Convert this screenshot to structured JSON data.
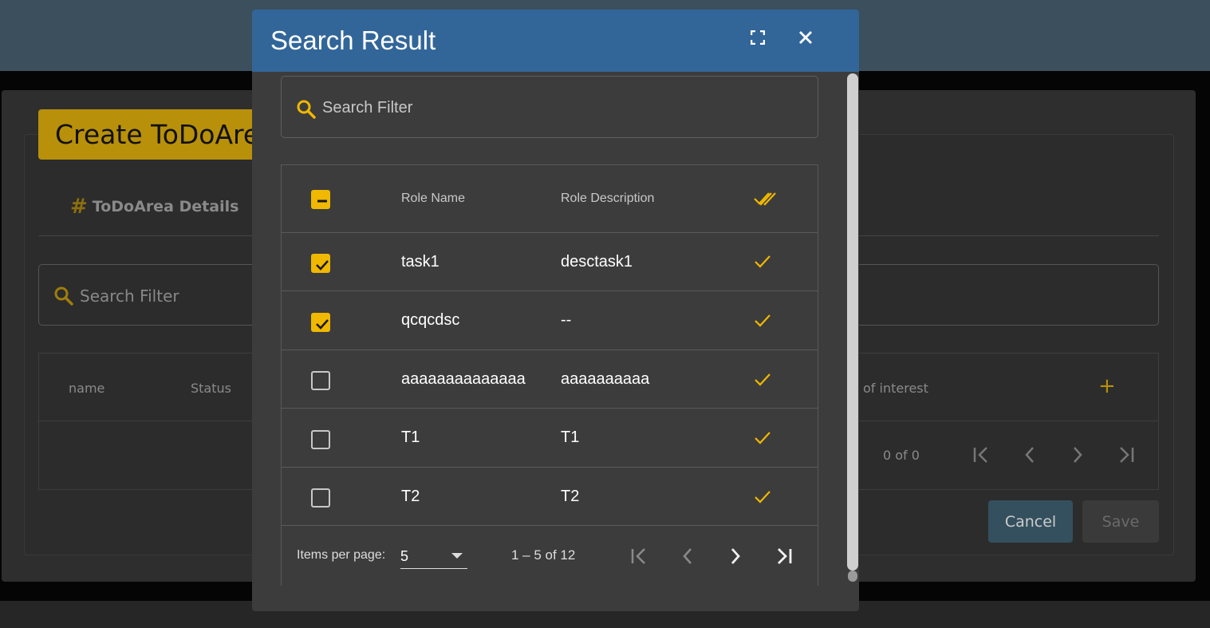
{
  "background": {
    "page_title": "Create ToDoArea",
    "tab_label": "ToDoArea Details",
    "search_placeholder": "Search Filter",
    "columns": [
      "name",
      "Status",
      "of interest"
    ],
    "pager_range": "0 of 0",
    "cancel_label": "Cancel",
    "save_label": "Save"
  },
  "dialog": {
    "title": "Search Result",
    "search_placeholder": "Search Filter",
    "columns": {
      "name": "Role Name",
      "description": "Role Description"
    },
    "rows": [
      {
        "name": "task1",
        "description": "desctask1",
        "selected": true
      },
      {
        "name": "qcqcdsc",
        "description": "--",
        "selected": true
      },
      {
        "name": "aaaaaaaaaaaaaa",
        "description": "aaaaaaaaaa",
        "selected": false
      },
      {
        "name": "T1",
        "description": "T1",
        "selected": false
      },
      {
        "name": "T2",
        "description": "T2",
        "selected": false
      }
    ],
    "paginator": {
      "items_per_page_label": "Items per page:",
      "page_size": "5",
      "range_label": "1 – 5 of 12"
    }
  },
  "colors": {
    "accent": "#f0b800",
    "header": "#326699",
    "dialog_bg": "#3c3c3c"
  }
}
